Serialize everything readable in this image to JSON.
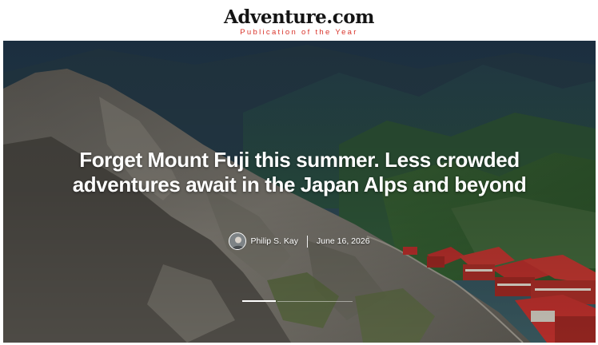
{
  "masthead": {
    "logo": "Adventure.com",
    "tagline": "Publication of the Year"
  },
  "hero": {
    "headline": "Forget Mount Fuji this summer. Less crowded adventures await in the Japan Alps and beyond",
    "author": "Philip S. Kay",
    "date": "June 16, 2026",
    "slide_progress": {
      "current": 1,
      "total": 3
    }
  },
  "colors": {
    "logo_text": "#141414",
    "tagline_red": "#d9342b",
    "headline_text": "#ffffff",
    "roof_red": "#c4322e"
  },
  "icons": {
    "avatar": "author-avatar"
  }
}
